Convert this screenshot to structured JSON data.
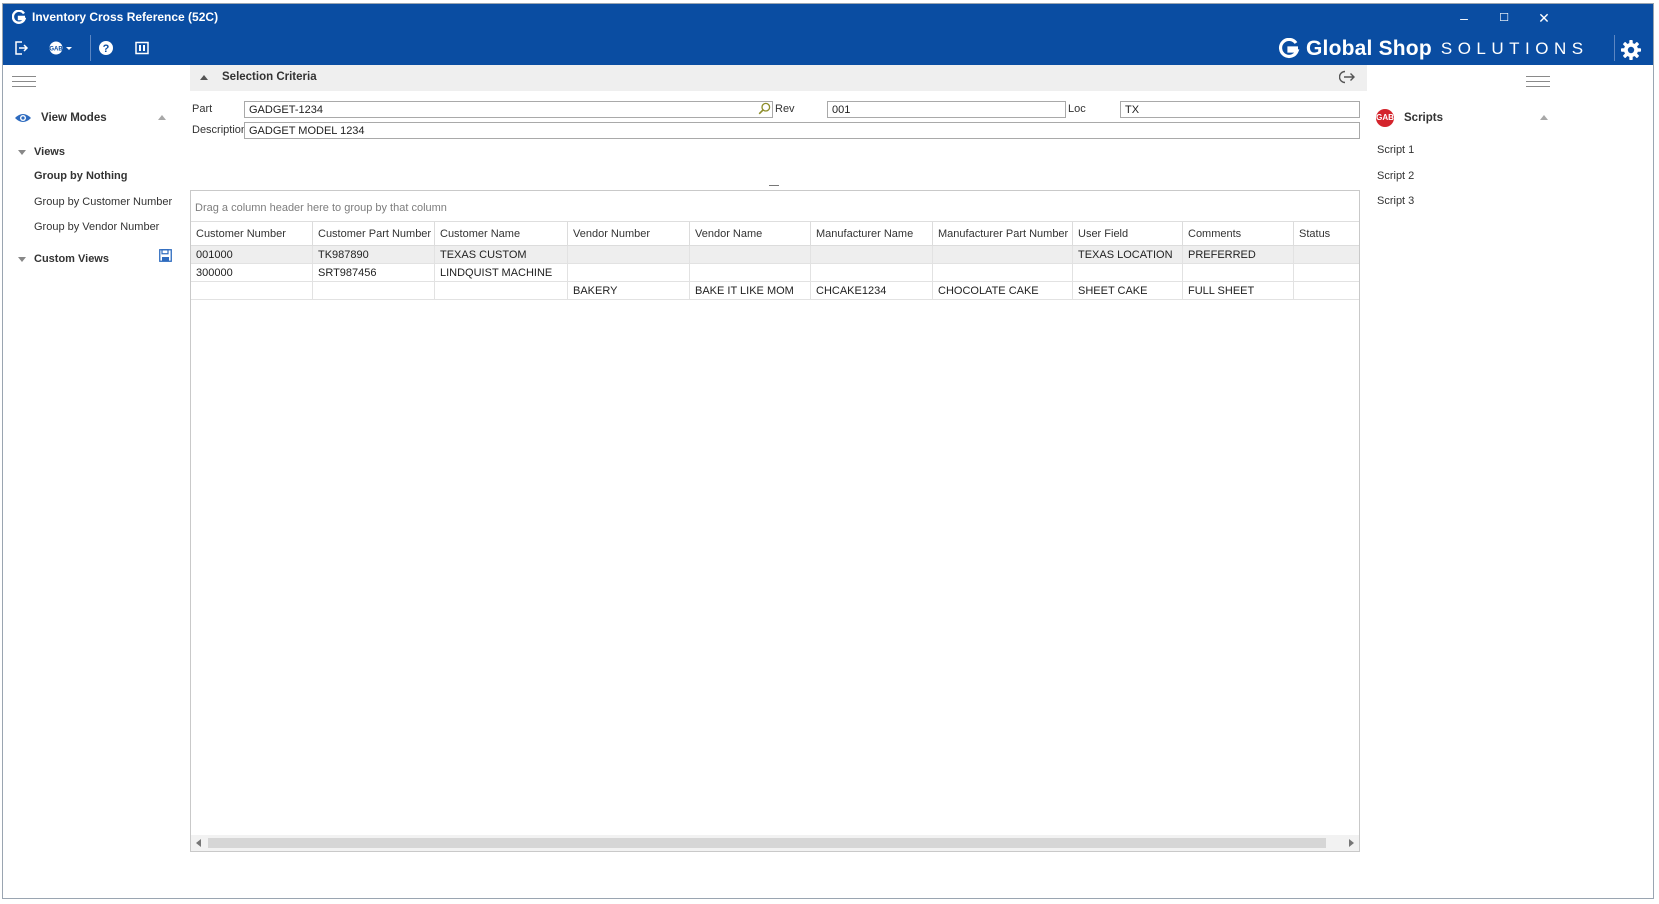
{
  "window": {
    "title": "Inventory Cross Reference (52C)",
    "minimize": "–",
    "maximize": "☐",
    "close": "✕"
  },
  "toolbar": {
    "icons": [
      "exit-icon",
      "gab-icon",
      "help-icon",
      "layout-icon"
    ],
    "brand_bold": "Global Shop",
    "brand_light": "SOLUTIONS"
  },
  "colors": {
    "titlebar": "#0a4da2",
    "accent": "#2e6bbf",
    "scripts_badge": "#d4242c"
  },
  "left_pane": {
    "view_modes_label": "View Modes",
    "views_label": "Views",
    "views": [
      "Group by Nothing",
      "Group by Customer Number",
      "Group by Vendor Number"
    ],
    "selected_view": "Group by Nothing",
    "custom_views_label": "Custom Views"
  },
  "criteria": {
    "title": "Selection Criteria",
    "part_label": "Part",
    "part_value": "GADGET-1234",
    "rev_label": "Rev",
    "rev_value": "001",
    "loc_label": "Loc",
    "loc_value": "TX",
    "description_label": "Description",
    "description_value": "GADGET MODEL 1234"
  },
  "grid": {
    "group_hint": "Drag a column header here to group by that column",
    "columns": [
      "Customer Number",
      "Customer Part Number",
      "Customer Name",
      "Vendor Number",
      "Vendor Name",
      "Manufacturer Name",
      "Manufacturer Part Number",
      "User Field",
      "Comments",
      "Status"
    ],
    "rows": [
      [
        "001000",
        "TK987890",
        "TEXAS CUSTOM",
        "",
        "",
        "",
        "",
        "TEXAS LOCATION",
        "PREFERRED",
        ""
      ],
      [
        "300000",
        "SRT987456",
        "LINDQUIST MACHINE",
        "",
        "",
        "",
        "",
        "",
        "",
        ""
      ],
      [
        "",
        "",
        "",
        "BAKERY",
        "BAKE IT LIKE MOM",
        "CHCAKE1234",
        "CHOCOLATE CAKE",
        "SHEET CAKE",
        "FULL SHEET",
        ""
      ]
    ]
  },
  "right_pane": {
    "scripts_label": "Scripts",
    "scripts_badge": "GAB",
    "scripts": [
      "Script 1",
      "Script 2",
      "Script 3"
    ]
  }
}
